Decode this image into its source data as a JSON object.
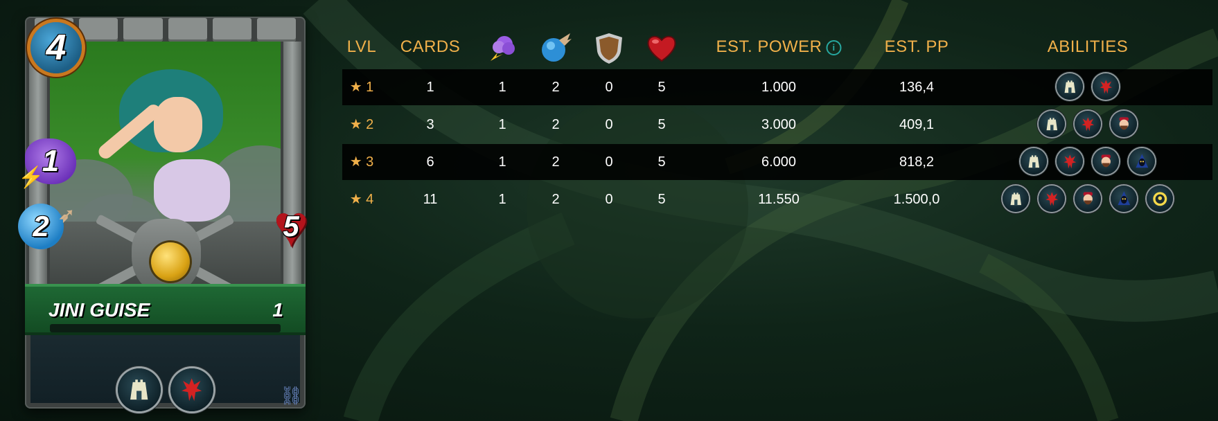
{
  "card": {
    "name": "JINI GUISE",
    "level": "1",
    "mana": "4",
    "magic": "1",
    "speed": "2",
    "health": "5",
    "abilities": [
      "shield-tower-icon",
      "demon-mask-icon"
    ]
  },
  "table": {
    "headers": {
      "lvl": "LVL",
      "cards": "CARDS",
      "magic_icon": "magic-attack-icon",
      "speed_icon": "speed-icon",
      "armor_icon": "armor-shield-icon",
      "health_icon": "health-heart-icon",
      "est_power": "EST. POWER",
      "info_icon": "i",
      "est_pp": "EST. PP",
      "abilities": "ABILITIES"
    },
    "rows": [
      {
        "lvl": "★ 1",
        "cards": "1",
        "magic": "1",
        "speed": "2",
        "armor": "0",
        "health": "5",
        "est_power": "1.000",
        "est_pp": "136,4",
        "abilities": [
          "shield-tower-icon",
          "demon-mask-icon"
        ]
      },
      {
        "lvl": "★ 2",
        "cards": "3",
        "magic": "1",
        "speed": "2",
        "armor": "0",
        "health": "5",
        "est_power": "3.000",
        "est_pp": "409,1",
        "abilities": [
          "shield-tower-icon",
          "demon-mask-icon",
          "bearded-face-icon"
        ]
      },
      {
        "lvl": "★ 3",
        "cards": "6",
        "magic": "1",
        "speed": "2",
        "armor": "0",
        "health": "5",
        "est_power": "6.000",
        "est_pp": "818,2",
        "abilities": [
          "shield-tower-icon",
          "demon-mask-icon",
          "bearded-face-icon",
          "hooded-figure-icon"
        ]
      },
      {
        "lvl": "★ 4",
        "cards": "11",
        "magic": "1",
        "speed": "2",
        "armor": "0",
        "health": "5",
        "est_power": "11.550",
        "est_pp": "1.500,0",
        "abilities": [
          "shield-tower-icon",
          "demon-mask-icon",
          "bearded-face-icon",
          "hooded-figure-icon",
          "glowing-face-icon"
        ]
      }
    ]
  },
  "colors": {
    "header_gold": "#f0b04a",
    "row_dark": "#000000",
    "name_band": "#1f6a35"
  }
}
